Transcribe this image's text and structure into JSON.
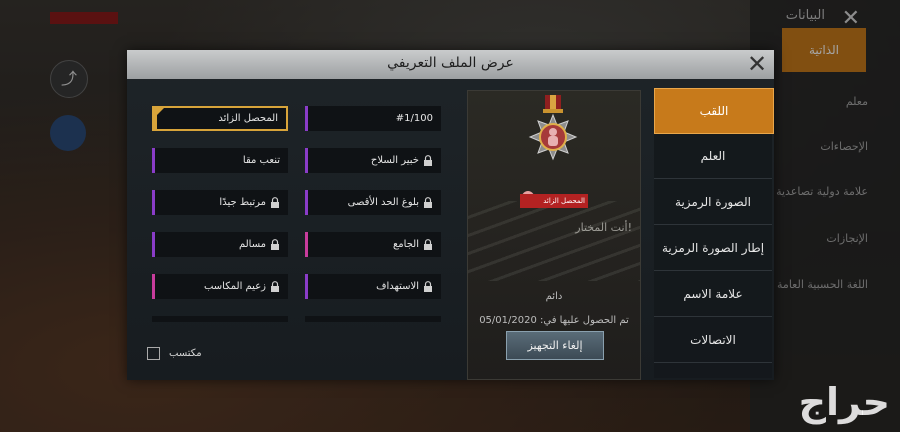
{
  "background": {
    "panel_title": "البيانات",
    "panel_active_item": "الذاتية",
    "panel_items": [
      "معلم",
      "الإحصاءات",
      "علامة دولية تصاعدية",
      "الإنجازات",
      "اللغة الحسبية العامة"
    ]
  },
  "dialog": {
    "title": "عرض الملف التعريفي"
  },
  "tabs": [
    {
      "label": "اللقب",
      "active": true
    },
    {
      "label": "العلم"
    },
    {
      "label": "الصورة الرمزية"
    },
    {
      "label": "إطار الصورة الرمزية"
    },
    {
      "label": "علامة الاسم"
    },
    {
      "label": "الاتصالات"
    }
  ],
  "preview": {
    "badge_name": "المحصل الزائد",
    "quote": "أنت المختار!",
    "duration": "دائم",
    "obtained": "تم الحصول عليها في: 05/01/2020",
    "unequip_label": "إلغاء التجهيز"
  },
  "titles": [
    {
      "label": "#1/100",
      "locked": false,
      "color": "#8a3cc8",
      "col": 0
    },
    {
      "label": "المحصل الزائد",
      "locked": false,
      "color": "#d8a43a",
      "col": 1,
      "selected": true
    },
    {
      "label": "خبير السلاح",
      "locked": true,
      "color": "#8a3cc8",
      "col": 0
    },
    {
      "label": "تنعب مقا",
      "locked": false,
      "color": "#8a3cc8",
      "col": 1
    },
    {
      "label": "بلوغ الحد الأقصى",
      "locked": true,
      "color": "#8a3cc8",
      "col": 0
    },
    {
      "label": "مرتبط جيدًا",
      "locked": true,
      "color": "#8a3cc8",
      "col": 1
    },
    {
      "label": "الجامع",
      "locked": true,
      "color": "#c83c9c",
      "col": 0
    },
    {
      "label": "مسالم",
      "locked": true,
      "color": "#8a3cc8",
      "col": 1
    },
    {
      "label": "الاستهداف",
      "locked": true,
      "color": "#8a3cc8",
      "col": 0
    },
    {
      "label": "زعيم المكاسب",
      "locked": true,
      "color": "#c83c9c",
      "col": 1
    }
  ],
  "owned_filter": {
    "label": "مكتسب",
    "checked": false
  },
  "watermark": "حراج"
}
